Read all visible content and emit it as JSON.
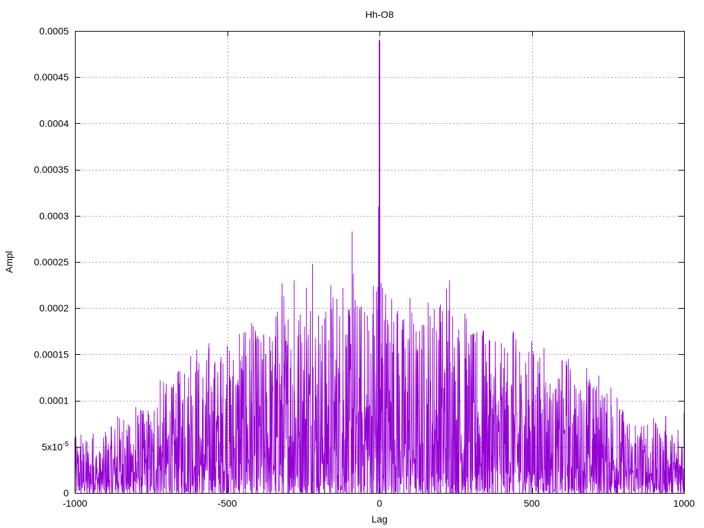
{
  "chart_data": {
    "type": "line",
    "title": "Hh-O8",
    "xlabel": "Lag",
    "ylabel": "Ampl",
    "xlim": [
      -1000,
      1000
    ],
    "ylim": [
      0,
      0.0005
    ],
    "grid": true,
    "legend": "none",
    "x_ticks": [
      {
        "value": -1000,
        "label": "-1000"
      },
      {
        "value": -500,
        "label": "-500"
      },
      {
        "value": 0,
        "label": "0"
      },
      {
        "value": 500,
        "label": "500"
      },
      {
        "value": 1000,
        "label": "1000"
      }
    ],
    "y_ticks": [
      {
        "value": 0,
        "label": "0",
        "sup": ""
      },
      {
        "value": 5e-05,
        "label": "5x10",
        "sup": "-5"
      },
      {
        "value": 0.0001,
        "label": "0.0001",
        "sup": ""
      },
      {
        "value": 0.00015,
        "label": "0.00015",
        "sup": ""
      },
      {
        "value": 0.0002,
        "label": "0.0002",
        "sup": ""
      },
      {
        "value": 0.00025,
        "label": "0.00025",
        "sup": ""
      },
      {
        "value": 0.0003,
        "label": "0.0003",
        "sup": ""
      },
      {
        "value": 0.00035,
        "label": "0.00035",
        "sup": ""
      },
      {
        "value": 0.0004,
        "label": "0.0004",
        "sup": ""
      },
      {
        "value": 0.00045,
        "label": "0.00045",
        "sup": ""
      },
      {
        "value": 0.0005,
        "label": "0.0005",
        "sup": ""
      }
    ],
    "series": [
      {
        "color": "#9400d3",
        "x": [
          -1020,
          -1000,
          -980,
          -960,
          -940,
          -920,
          -900,
          -880,
          -860,
          -840,
          -820,
          -800,
          -780,
          -760,
          -740,
          -720,
          -700,
          -680,
          -660,
          -640,
          -620,
          -600,
          -580,
          -560,
          -540,
          -520,
          -500,
          -480,
          -460,
          -440,
          -420,
          -400,
          -380,
          -360,
          -340,
          -320,
          -300,
          -280,
          -260,
          -240,
          -220,
          -200,
          -180,
          -160,
          -140,
          -120,
          -100,
          -90,
          -80,
          -60,
          -40,
          -20,
          -10,
          -5,
          0,
          5,
          10,
          20,
          40,
          60,
          80,
          100,
          120,
          140,
          160,
          180,
          200,
          220,
          230,
          240,
          260,
          280,
          300,
          320,
          340,
          360,
          380,
          400,
          420,
          440,
          460,
          480,
          500,
          520,
          540,
          560,
          580,
          600,
          620,
          640,
          660,
          680,
          700,
          720,
          740,
          760,
          780,
          800,
          820,
          840,
          860,
          880,
          900,
          920,
          940,
          960,
          980,
          1000,
          1020
        ],
        "y": [
          3.4e-05,
          6e-05,
          6.3e-05,
          5.5e-05,
          6.4e-05,
          4.5e-05,
          6.6e-05,
          7.2e-05,
          8.3e-05,
          7.9e-05,
          7.2e-05,
          9.3e-05,
          8.9e-05,
          8.9e-05,
          8.9e-05,
          0.000122,
          0.000118,
          0.000114,
          0.000132,
          0.000129,
          0.000148,
          0.000155,
          0.000125,
          0.000162,
          0.000142,
          0.000147,
          0.000159,
          0.000144,
          0.000172,
          0.000174,
          0.000184,
          0.00017,
          0.000171,
          0.000169,
          0.000191,
          0.000227,
          0.000188,
          0.00023,
          0.000193,
          0.000222,
          0.000248,
          0.000192,
          0.000189,
          0.000225,
          0.00021,
          0.000222,
          0.000196,
          0.000283,
          0.000209,
          0.000202,
          0.000192,
          0.000224,
          0.000218,
          0.000223,
          0.00049,
          0.000227,
          0.000222,
          0.000215,
          0.00021,
          0.000197,
          0.000188,
          0.000211,
          0.000175,
          0.000182,
          0.000206,
          0.000199,
          0.000204,
          0.000221,
          0.00023,
          0.000191,
          0.000177,
          0.000194,
          0.000171,
          0.000174,
          0.000176,
          0.000165,
          0.000164,
          0.000162,
          0.000152,
          0.000175,
          0.000153,
          0.000141,
          0.000164,
          0.000142,
          0.000157,
          0.000118,
          0.000113,
          0.000144,
          0.000145,
          0.000117,
          0.000111,
          0.000135,
          0.000113,
          0.000127,
          0.000104,
          0.000114,
          0.000103,
          8.8e-05,
          7.5e-05,
          7.3e-05,
          7.2e-05,
          7.4e-05,
          8.1e-05,
          6.4e-05,
          8.3e-05,
          6.3e-05,
          6.8e-05,
          8.7e-05,
          7.3e-05
        ]
      }
    ]
  }
}
